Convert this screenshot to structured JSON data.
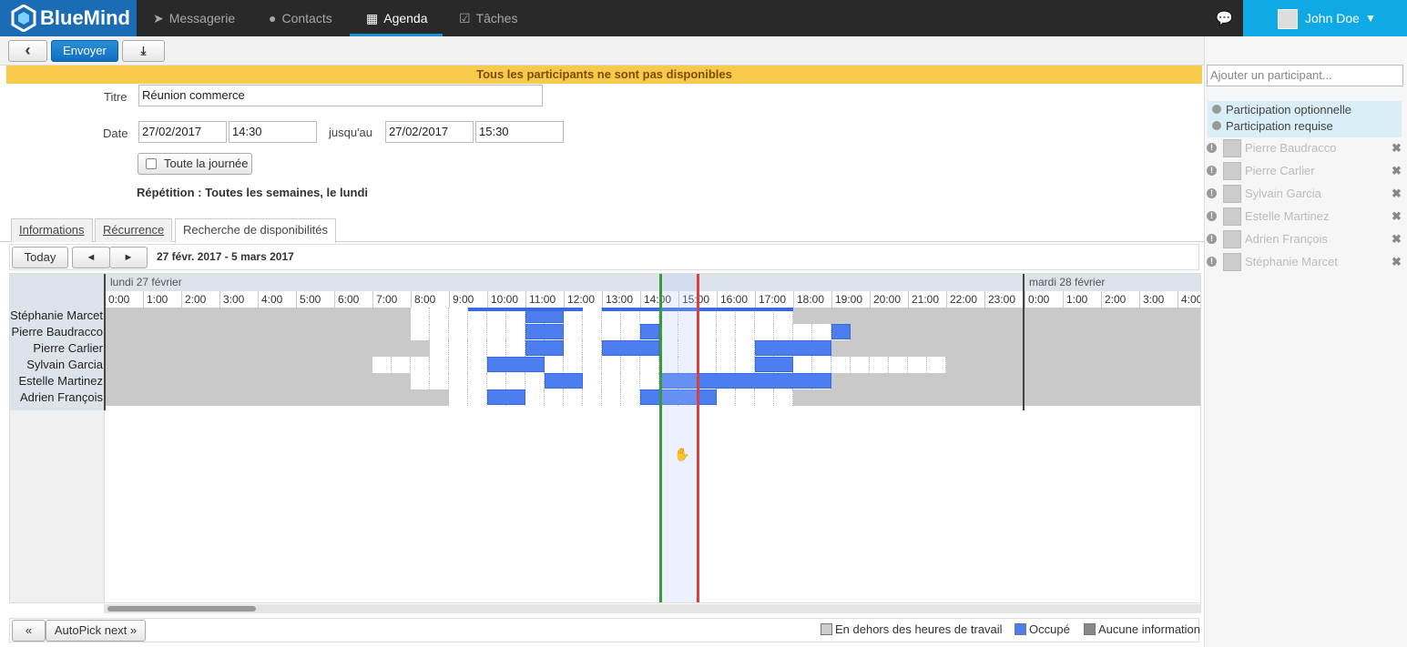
{
  "app": {
    "name": "BlueMind"
  },
  "nav": [
    {
      "label": "Messagerie",
      "icon": "paper-plane-icon"
    },
    {
      "label": "Contacts",
      "icon": "person-icon"
    },
    {
      "label": "Agenda",
      "icon": "calendar-icon",
      "active": true
    },
    {
      "label": "Tâches",
      "icon": "task-icon"
    }
  ],
  "user": {
    "name": "John Doe",
    "caret": "▼"
  },
  "toolbar": {
    "back": "‹",
    "send": "Envoyer",
    "download": "⤓"
  },
  "warning": "Tous les participants ne sont pas disponibles",
  "form": {
    "title_label": "Titre",
    "title_value": "Réunion commerce",
    "date_label": "Date",
    "start_date": "27/02/2017",
    "start_time": "14:30",
    "until_label": "jusqu'au",
    "end_date": "27/02/2017",
    "end_time": "15:30",
    "allday_label": "Toute la journée",
    "repeat": "Répétition : Toutes les semaines, le lundi"
  },
  "tabs": [
    "Informations",
    "Récurrence",
    "Recherche de disponibilités"
  ],
  "scheduler": {
    "today": "Today",
    "prev": "◄",
    "next": "►",
    "range": "27 févr. 2017 - 5 mars 2017",
    "day1": "lundi 27 février",
    "day2": "mardi 28 février",
    "hours": [
      "0:00",
      "1:00",
      "2:00",
      "3:00",
      "4:00",
      "5:00",
      "6:00",
      "7:00",
      "8:00",
      "9:00",
      "10:00",
      "11:00",
      "12:00",
      "13:00",
      "14:00",
      "15:00",
      "16:00",
      "17:00",
      "18:00",
      "19:00",
      "20:00",
      "21:00",
      "22:00",
      "23:00"
    ],
    "hours2": [
      "0:00",
      "1:00",
      "2:00",
      "3:00",
      "4:00"
    ],
    "people": [
      "Stéphanie Marcet",
      "Pierre Baudracco",
      "Pierre Carlier",
      "Sylvain Garcia",
      "Estelle Martinez",
      "Adrien François"
    ],
    "autopick_prev": "«",
    "autopick_next": "AutoPick next »"
  },
  "legend": {
    "outside": "En dehors des heures de travail",
    "busy": "Occupé",
    "noinfo": "Aucune information"
  },
  "sidebar": {
    "add_placeholder": "Ajouter un participant...",
    "optional": "Participation optionnelle",
    "required": "Participation requise",
    "participants": [
      "Pierre Baudracco",
      "Pierre Carlier",
      "Sylvain Garcia",
      "Estelle Martinez",
      "Adrien François",
      "Stéphanie Marcet"
    ]
  },
  "colors": {
    "brand": "#1a6db5",
    "accent": "#0fa9e6",
    "busy": "#4c7ef0",
    "warning": "#f8c94a"
  }
}
